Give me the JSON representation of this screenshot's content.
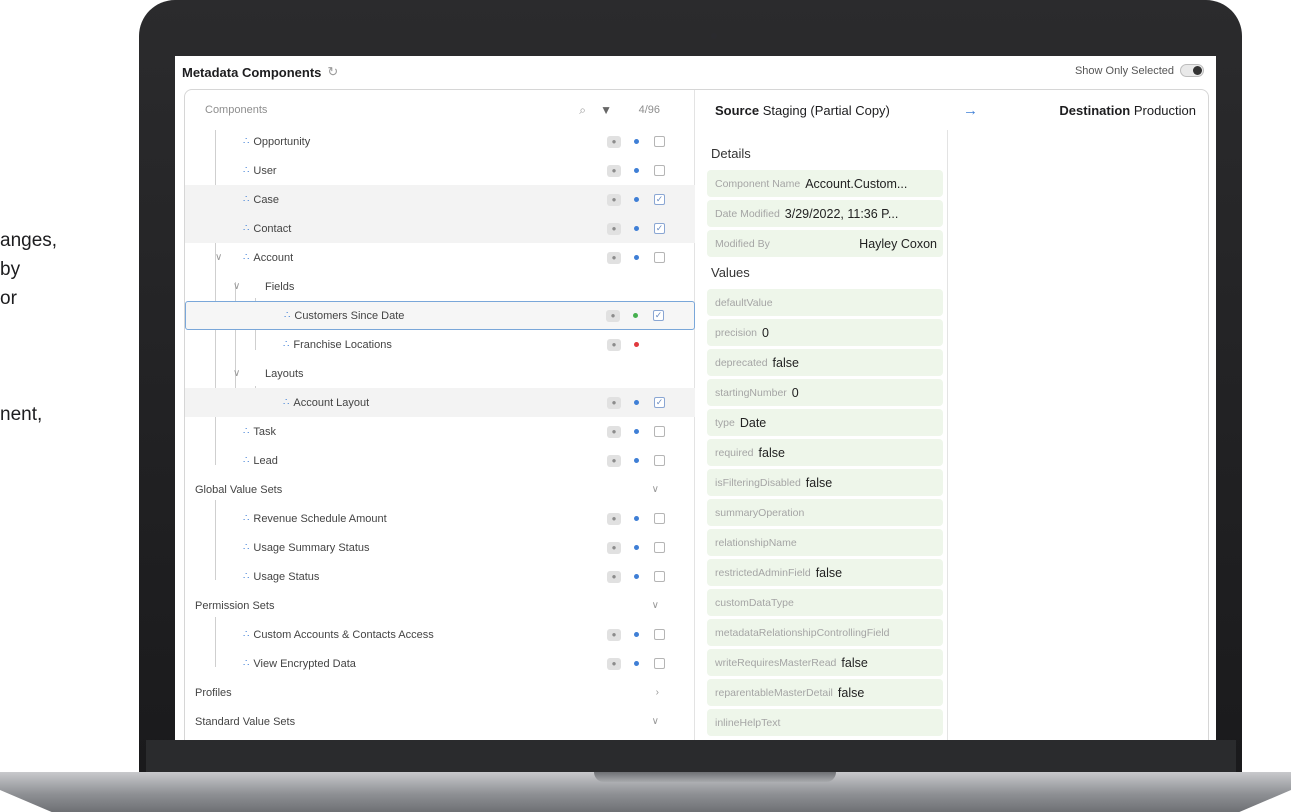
{
  "left_text": [
    "anges,",
    "by",
    "or",
    "nent,"
  ],
  "header": {
    "title": "Metadata Components",
    "show_only_selected": "Show Only Selected"
  },
  "tree": {
    "column_label": "Components",
    "count": "4/96",
    "rows": [
      {
        "label": "Opportunity",
        "checked": false,
        "dot": "#3f7fd6"
      },
      {
        "label": "User",
        "checked": false,
        "dot": "#3f7fd6"
      },
      {
        "label": "Case",
        "checked": true,
        "dot": "#3f7fd6"
      },
      {
        "label": "Contact",
        "checked": true,
        "dot": "#3f7fd6"
      },
      {
        "label": "Account",
        "checked": false,
        "dot": "#3f7fd6"
      },
      {
        "label": "Fields"
      },
      {
        "label": "Customers Since Date",
        "checked": true,
        "dot": "#46b04f"
      },
      {
        "label": "Franchise Locations",
        "dot": "#e0393e"
      },
      {
        "label": "Layouts"
      },
      {
        "label": "Account Layout",
        "checked": true,
        "dot": "#3f7fd6"
      },
      {
        "label": "Task",
        "checked": false,
        "dot": "#3f7fd6"
      },
      {
        "label": "Lead",
        "checked": false,
        "dot": "#3f7fd6"
      },
      {
        "label": "Global Value Sets"
      },
      {
        "label": "Revenue Schedule Amount",
        "checked": false,
        "dot": "#3f7fd6"
      },
      {
        "label": "Usage Summary Status",
        "checked": false,
        "dot": "#3f7fd6"
      },
      {
        "label": "Usage Status",
        "checked": false,
        "dot": "#3f7fd6"
      },
      {
        "label": "Permission Sets"
      },
      {
        "label": "Custom Accounts & Contacts Access",
        "checked": false,
        "dot": "#3f7fd6"
      },
      {
        "label": "View Encrypted Data",
        "checked": false,
        "dot": "#3f7fd6"
      },
      {
        "label": "Profiles"
      },
      {
        "label": "Standard Value Sets"
      }
    ]
  },
  "detail": {
    "source_label": "Source",
    "source_value": "Staging (Partial Copy)",
    "destination_label": "Destination",
    "destination_value": "Production",
    "details_heading": "Details",
    "values_heading": "Values",
    "details": [
      {
        "key": "Component Name",
        "value": "Account.Custom..."
      },
      {
        "key": "Date Modified",
        "value": "3/29/2022, 11:36 P..."
      },
      {
        "key": "Modified By",
        "value": "Hayley Coxon"
      }
    ],
    "values": [
      {
        "key": "defaultValue",
        "value": ""
      },
      {
        "key": "precision",
        "value": "0"
      },
      {
        "key": "deprecated",
        "value": "false"
      },
      {
        "key": "startingNumber",
        "value": "0"
      },
      {
        "key": "type",
        "value": "Date"
      },
      {
        "key": "required",
        "value": "false"
      },
      {
        "key": "isFilteringDisabled",
        "value": "false"
      },
      {
        "key": "summaryOperation",
        "value": ""
      },
      {
        "key": "relationshipName",
        "value": ""
      },
      {
        "key": "restrictedAdminField",
        "value": "false"
      },
      {
        "key": "customDataType",
        "value": ""
      },
      {
        "key": "metadataRelationshipControllingField",
        "value": ""
      },
      {
        "key": "writeRequiresMasterRead",
        "value": "false"
      },
      {
        "key": "reparentableMasterDetail",
        "value": "false"
      },
      {
        "key": "inlineHelpText",
        "value": ""
      }
    ]
  }
}
